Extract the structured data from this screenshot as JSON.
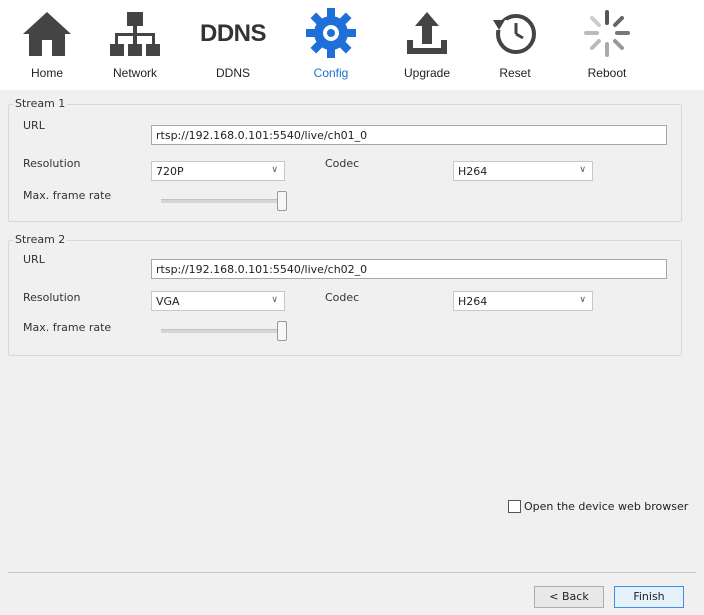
{
  "toolbar": {
    "items": [
      {
        "label": "Home",
        "icon": "home-icon"
      },
      {
        "label": "Network",
        "icon": "network-icon"
      },
      {
        "label": "DDNS",
        "icon": "ddns-icon",
        "logo_text": "DDNS"
      },
      {
        "label": "Config",
        "icon": "gear-icon",
        "active": true
      },
      {
        "label": "Upgrade",
        "icon": "upgrade-icon"
      },
      {
        "label": "Reset",
        "icon": "reset-icon"
      },
      {
        "label": "Reboot",
        "icon": "reboot-icon"
      }
    ],
    "active_color": "#1e6fd8"
  },
  "stream1": {
    "title": "Stream 1",
    "url_label": "URL",
    "url_value": "rtsp://192.168.0.101:5540/live/ch01_0",
    "resolution_label": "Resolution",
    "resolution_value": "720P",
    "codec_label": "Codec",
    "codec_value": "H264",
    "framerate_label": "Max. frame rate",
    "framerate_level": 1.0
  },
  "stream2": {
    "title": "Stream 2",
    "url_label": "URL",
    "url_value": "rtsp://192.168.0.101:5540/live/ch02_0",
    "resolution_label": "Resolution",
    "resolution_value": "VGA",
    "codec_label": "Codec",
    "codec_value": "H264",
    "framerate_label": "Max. frame rate",
    "framerate_level": 1.0
  },
  "open_browser": {
    "label": "Open the device web browser",
    "checked": false
  },
  "buttons": {
    "back": "< Back",
    "finish": "Finish"
  }
}
